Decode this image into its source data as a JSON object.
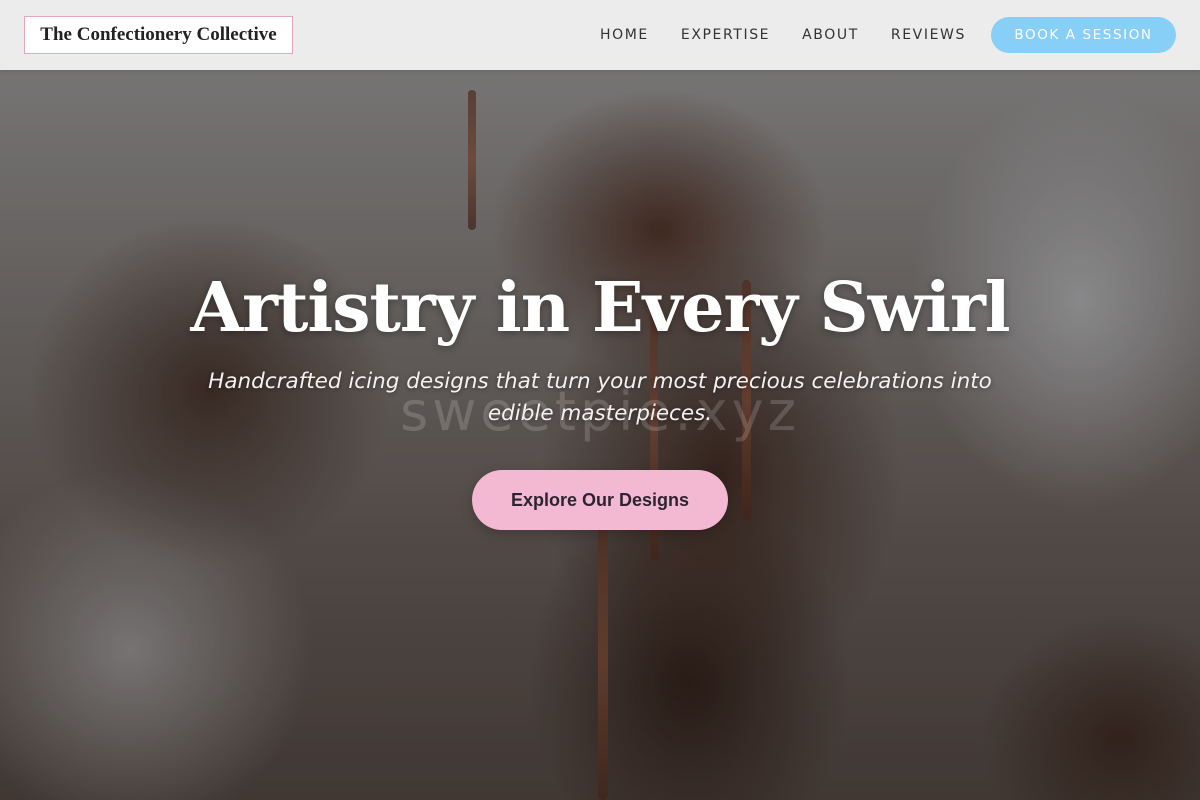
{
  "header": {
    "logo_text": "The Confectionery Collective",
    "nav": [
      {
        "label": "HOME"
      },
      {
        "label": "EXPERTISE"
      },
      {
        "label": "ABOUT"
      },
      {
        "label": "REVIEWS"
      }
    ],
    "cta_label": "BOOK A SESSION"
  },
  "hero": {
    "headline": "Artistry in Every Swirl",
    "subtitle": "Handcrafted icing designs that turn your most precious celebrations into edible masterpieces.",
    "button_label": "Explore Our Designs",
    "watermark": "sweetpie.xyz"
  },
  "colors": {
    "accent_blue": "#87cff7",
    "accent_pink": "#f4b9d2",
    "logo_border": "#e4a7bf"
  }
}
